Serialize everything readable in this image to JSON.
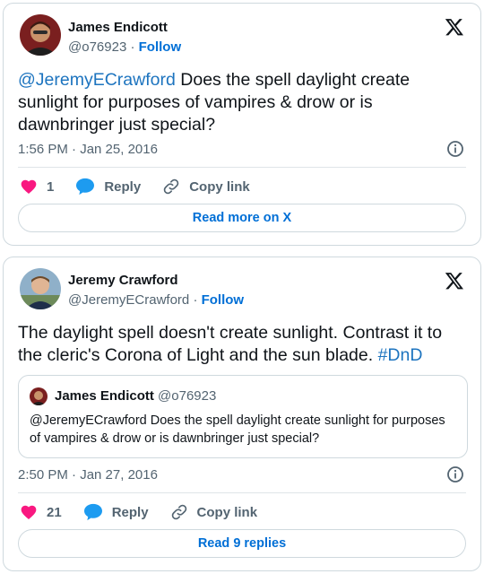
{
  "tweet1": {
    "author_name": "James Endicott",
    "author_handle": "@o76923",
    "separator": "·",
    "follow_label": "Follow",
    "text_mention": "@JeremyECrawford",
    "text_body": " Does the spell daylight create sunlight for purposes of vampires & drow or is dawnbringer just special?",
    "timestamp": "1:56 PM · Jan 25, 2016",
    "like_count": "1",
    "reply_label": "Reply",
    "copy_link_label": "Copy link",
    "more_label": "Read more on X"
  },
  "tweet2": {
    "author_name": "Jeremy Crawford",
    "author_handle": "@JeremyECrawford",
    "separator": "·",
    "follow_label": "Follow",
    "text_body": "The daylight spell doesn't create sunlight. Contrast it to the cleric's Corona of Light and the sun blade. ",
    "text_hashtag": "#DnD",
    "quote": {
      "author_name": "James Endicott",
      "author_handle": "@o76923",
      "text": "@JeremyECrawford Does the spell daylight create sunlight for purposes of vampires & drow or is dawnbringer just special?"
    },
    "timestamp": "2:50 PM · Jan 27, 2016",
    "like_count": "21",
    "reply_label": "Reply",
    "copy_link_label": "Copy link",
    "more_label": "Read 9 replies"
  },
  "colors": {
    "link": "#1d74bf",
    "like": "#f91880",
    "reply": "#1d9bf0",
    "border": "#cfd9de"
  },
  "icons": [
    "x-logo-icon",
    "info-icon",
    "heart-icon",
    "reply-bubble-icon",
    "link-icon"
  ]
}
